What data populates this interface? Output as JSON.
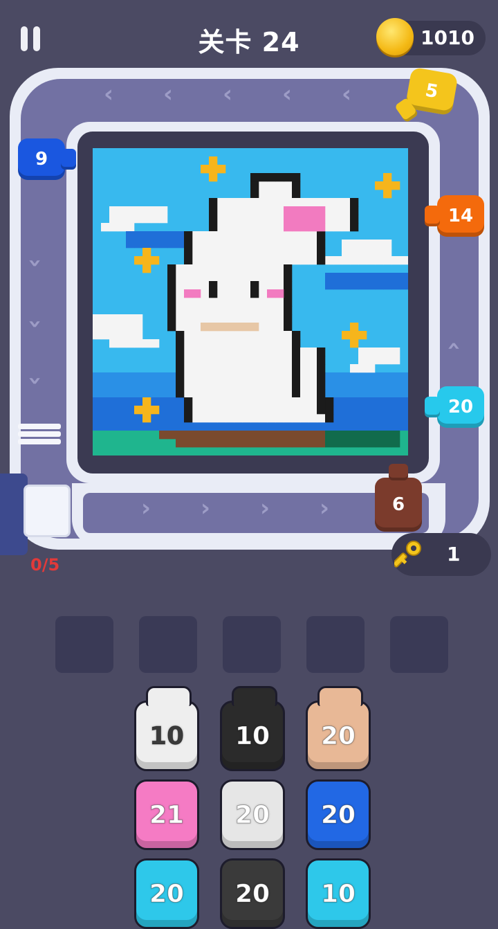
{
  "hud": {
    "title": "关卡 24",
    "coins": "1010",
    "keys": "1",
    "progress": "0/5"
  },
  "icons": {
    "pause": "pause-icon",
    "coin": "coin-icon",
    "key": "key-icon"
  },
  "track_cannons": [
    {
      "value": "9",
      "color": "#1a57e0"
    },
    {
      "value": "5",
      "color": "#f4c51c"
    },
    {
      "value": "14",
      "color": "#f46a0c"
    },
    {
      "value": "20",
      "color": "#27c9ec"
    },
    {
      "value": "6",
      "color": "#7b3b2c"
    }
  ],
  "tray": [
    {
      "value": "10",
      "color": "#eeeeee",
      "text_color": "#3a3a3a"
    },
    {
      "value": "10",
      "color": "#2b2b2b",
      "text_color": "#ffffff"
    },
    {
      "value": "20",
      "color": "#e8b896",
      "text_color": "#ffffff"
    },
    {
      "value": "21",
      "color": "#f57bc4",
      "text_color": "#ffffff"
    },
    {
      "value": "20",
      "color": "#e6e6e6",
      "text_color": "#ffffff"
    },
    {
      "value": "20",
      "color": "#2268e4",
      "text_color": "#ffffff"
    },
    {
      "value": "20",
      "color": "#2ec8ea",
      "text_color": "#ffffff"
    },
    {
      "value": "20",
      "color": "#3a3a3a",
      "text_color": "#ffffff"
    },
    {
      "value": "10",
      "color": "#2ec8ea",
      "text_color": "#ffffff"
    }
  ],
  "queue_slots": 5
}
